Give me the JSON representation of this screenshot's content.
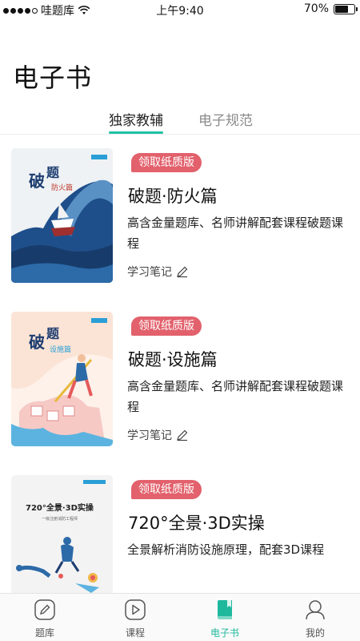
{
  "status_bar": {
    "carrier": "哇题库",
    "time": "上午9:40",
    "battery": "70%",
    "battery_level": 0.7
  },
  "header": {
    "title": "电子书"
  },
  "tabs": [
    {
      "label": "独家教辅",
      "active": true
    },
    {
      "label": "电子规范",
      "active": false
    }
  ],
  "books": [
    {
      "badge": "领取纸质版",
      "title": "破题·防火篇",
      "description": "高含金量题库、名师讲解配套课程破题课程",
      "notes_label": "学习笔记",
      "cover_theme": "wave-ship"
    },
    {
      "badge": "领取纸质版",
      "title": "破题·设施篇",
      "description": "高含金量题库、名师讲解配套课程破题课程",
      "notes_label": "学习笔记",
      "cover_theme": "rider-building"
    },
    {
      "badge": "领取纸质版",
      "title": "720°全景·3D实操",
      "description": "全景解析消防设施原理，配套3D课程",
      "notes_label": "",
      "cover_theme": "figures"
    }
  ],
  "bottom_nav": [
    {
      "label": "题库",
      "icon": "pencil-icon",
      "active": false
    },
    {
      "label": "课程",
      "icon": "video-icon",
      "active": false
    },
    {
      "label": "电子书",
      "icon": "book-icon",
      "active": true
    },
    {
      "label": "我的",
      "icon": "person-icon",
      "active": false
    }
  ],
  "colors": {
    "accent": "#1fc2a5",
    "badge": "#e2616c"
  }
}
